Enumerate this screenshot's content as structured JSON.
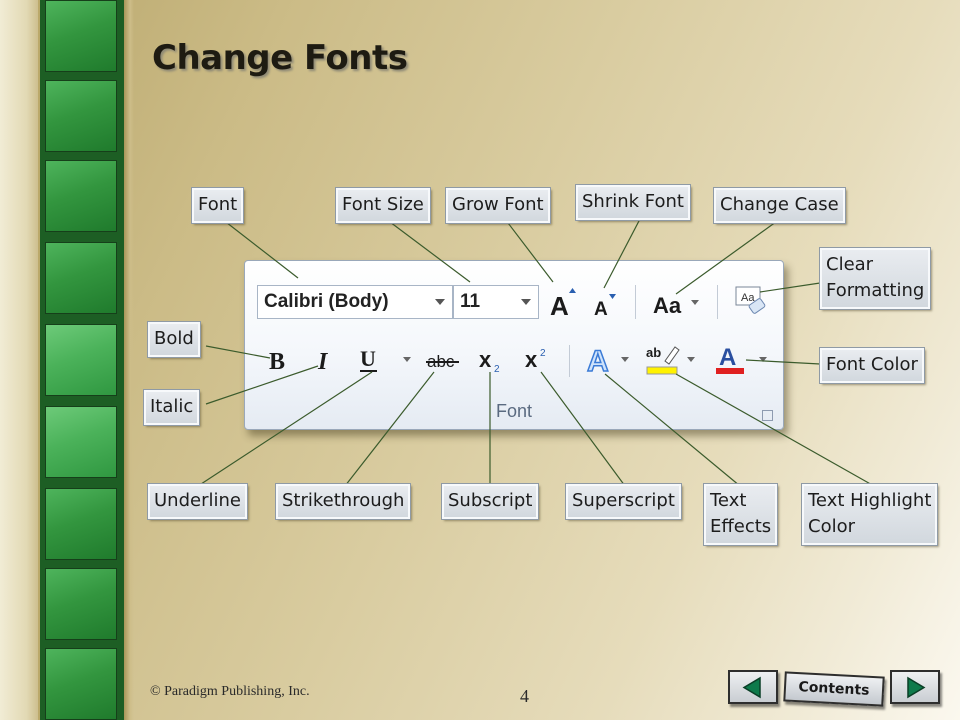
{
  "slide": {
    "title": "Change Fonts",
    "copyright": "© Paradigm Publishing, Inc.",
    "page_number": "4"
  },
  "ribbon": {
    "font_name": "Calibri (Body)",
    "font_size": "11",
    "group_label": "Font"
  },
  "callouts": {
    "font": "Font",
    "font_size": "Font Size",
    "grow_font": "Grow Font",
    "shrink_font": "Shrink Font",
    "change_case": "Change Case",
    "clear_formatting_line1": "Clear",
    "clear_formatting_line2": "Formatting",
    "bold": "Bold",
    "italic": "Italic",
    "font_color": "Font Color",
    "underline": "Underline",
    "strikethrough": "Strikethrough",
    "subscript": "Subscript",
    "superscript": "Superscript",
    "text_effects_line1": "Text",
    "text_effects_line2": "Effects",
    "text_highlight_line1": "Text Highlight",
    "text_highlight_line2": "Color"
  },
  "nav": {
    "contents_label": "Contents",
    "prev_icon": "left-triangle-icon",
    "next_icon": "right-triangle-icon"
  },
  "colors": {
    "strip_green": "#1d5e24",
    "tile_green": "#33963f",
    "connector": "#3b5b2c",
    "font_color_bar": "#e02020",
    "highlight_bar": "#fff200"
  }
}
